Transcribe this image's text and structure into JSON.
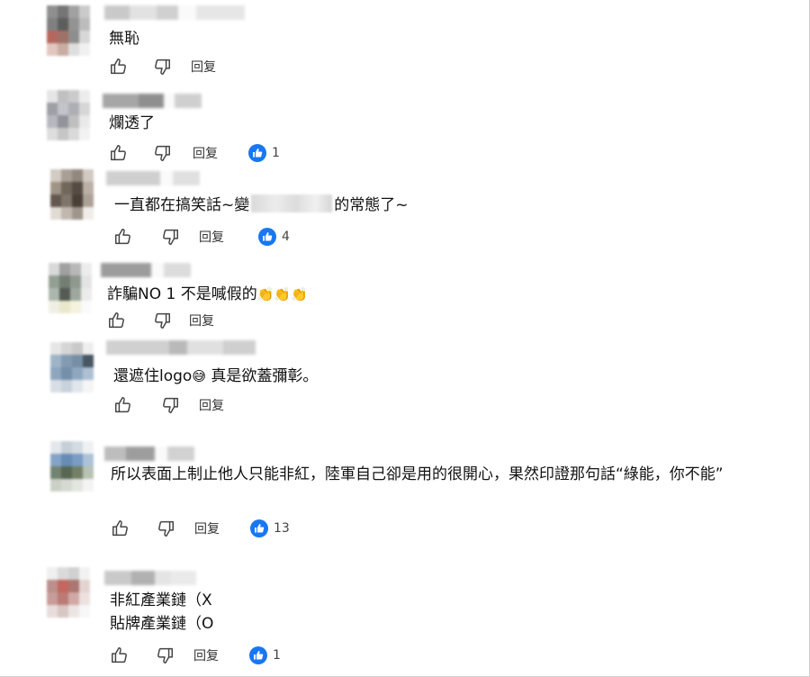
{
  "comments": [
    {
      "text": "無恥",
      "reply_label": "回复",
      "likes": ""
    },
    {
      "text": "爛透了",
      "reply_label": "回复",
      "likes": "1"
    },
    {
      "text_before": "一直都在搞笑話~變",
      "text_after": "的常態了~",
      "reply_label": "回复",
      "likes": "4"
    },
    {
      "text": "詐騙NO 1 不是喊假的",
      "emoji": "👏👏👏",
      "reply_label": "回复",
      "likes": ""
    },
    {
      "text_before": "還遮住logo",
      "emoji": "😅",
      "text_after": " 真是欲蓋彌彰。",
      "reply_label": "回复",
      "likes": ""
    },
    {
      "text": "所以表面上制止他人只能非紅，陸軍自己卻是用的很開心，果然印證那句話“綠能，你不能”",
      "reply_label": "回复",
      "likes": "13"
    },
    {
      "line1": "非紅產業鏈（X",
      "line2": "貼牌產業鏈（O",
      "reply_label": "回复",
      "likes": "1"
    }
  ],
  "icons": {
    "like": "thumbs-up-icon",
    "dislike": "thumbs-down-icon",
    "like_badge": "like-reaction-icon"
  },
  "colors": {
    "like_badge": "#1877f2",
    "icon_stroke": "#444444",
    "text": "#111111"
  }
}
